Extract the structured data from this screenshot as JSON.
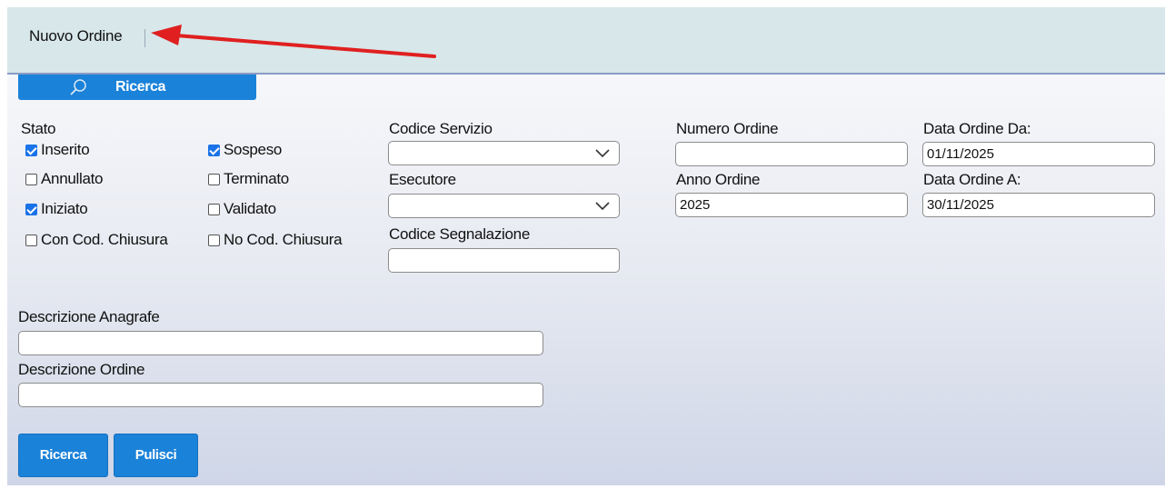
{
  "header": {
    "title": "Nuovo Ordine"
  },
  "search_tab": {
    "label": "Ricerca",
    "icon": "search-icon"
  },
  "stato": {
    "label": "Stato",
    "options": [
      {
        "label": "Inserito",
        "checked": true
      },
      {
        "label": "Sospeso",
        "checked": true
      },
      {
        "label": "Annullato",
        "checked": false
      },
      {
        "label": "Terminato",
        "checked": false
      },
      {
        "label": "Iniziato",
        "checked": true
      },
      {
        "label": "Validato",
        "checked": false
      },
      {
        "label": "Con Cod. Chiusura",
        "checked": false
      },
      {
        "label": "No Cod. Chiusura",
        "checked": false
      }
    ]
  },
  "fields": {
    "codice_servizio": {
      "label": "Codice Servizio",
      "value": ""
    },
    "esecutore": {
      "label": "Esecutore",
      "value": ""
    },
    "codice_segnalazione": {
      "label": "Codice Segnalazione",
      "value": ""
    },
    "numero_ordine": {
      "label": "Numero Ordine",
      "value": ""
    },
    "anno_ordine": {
      "label": "Anno Ordine",
      "value": "2025"
    },
    "data_ordine_da": {
      "label": "Data Ordine Da:",
      "value": "01/11/2025"
    },
    "data_ordine_a": {
      "label": "Data Ordine A:",
      "value": "30/11/2025"
    },
    "descrizione_anagrafe": {
      "label": "Descrizione Anagrafe",
      "value": ""
    },
    "descrizione_ordine": {
      "label": "Descrizione Ordine",
      "value": ""
    }
  },
  "buttons": {
    "ricerca": "Ricerca",
    "pulisci": "Pulisci"
  },
  "colors": {
    "accent": "#1b82d9",
    "header_bg": "#d7e7ea",
    "annotation_arrow": "#e02020"
  }
}
